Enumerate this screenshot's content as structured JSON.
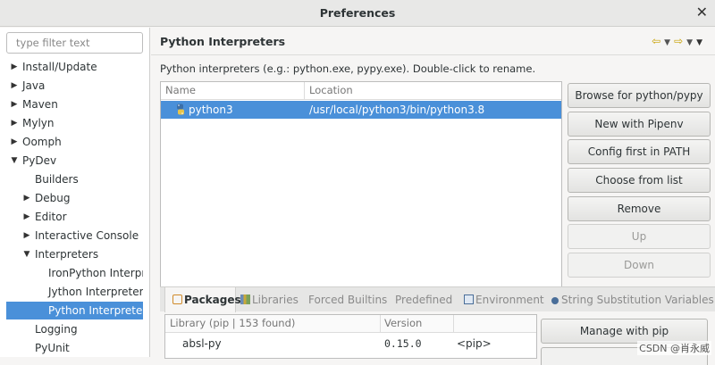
{
  "window": {
    "title": "Preferences"
  },
  "filter": {
    "placeholder": "type filter text"
  },
  "tree": {
    "items": [
      {
        "label": "Install/Update"
      },
      {
        "label": "Java"
      },
      {
        "label": "Maven"
      },
      {
        "label": "Mylyn"
      },
      {
        "label": "Oomph"
      },
      {
        "label": "PyDev"
      },
      {
        "label": "Builders"
      },
      {
        "label": "Debug"
      },
      {
        "label": "Editor"
      },
      {
        "label": "Interactive Console"
      },
      {
        "label": "Interpreters"
      },
      {
        "label": "IronPython Interpreter"
      },
      {
        "label": "Jython Interpreter"
      },
      {
        "label": "Python Interpreter"
      },
      {
        "label": "Logging"
      },
      {
        "label": "PyUnit"
      }
    ]
  },
  "page": {
    "title": "Python Interpreters",
    "hint": "Python interpreters (e.g.: python.exe, pypy.exe).   Double-click to rename."
  },
  "interpreters": {
    "columns": [
      "Name",
      "Location"
    ],
    "rows": [
      {
        "name": "python3",
        "location": "/usr/local/python3/bin/python3.8"
      }
    ]
  },
  "buttons": {
    "browse": "Browse for python/pypy exe",
    "pipenv": "New with Pipenv",
    "config_first": "Config first in PATH",
    "choose": "Choose from list",
    "remove": "Remove",
    "up": "Up",
    "down": "Down"
  },
  "tabs": [
    "Packages",
    "Libraries",
    "Forced Builtins",
    "Predefined",
    "Environment",
    "String Substitution Variables"
  ],
  "packages": {
    "columns": [
      "Library (pip | 153 found)",
      "Version"
    ],
    "rows": [
      {
        "name": "absl-py",
        "version": "0.15.0",
        "source": "<pip>"
      }
    ],
    "manage_button": "Manage with pip"
  },
  "watermark": "CSDN @肖永威",
  "colors": {
    "selection": "#4a90d9",
    "nav_arrow": "#c8a000"
  }
}
